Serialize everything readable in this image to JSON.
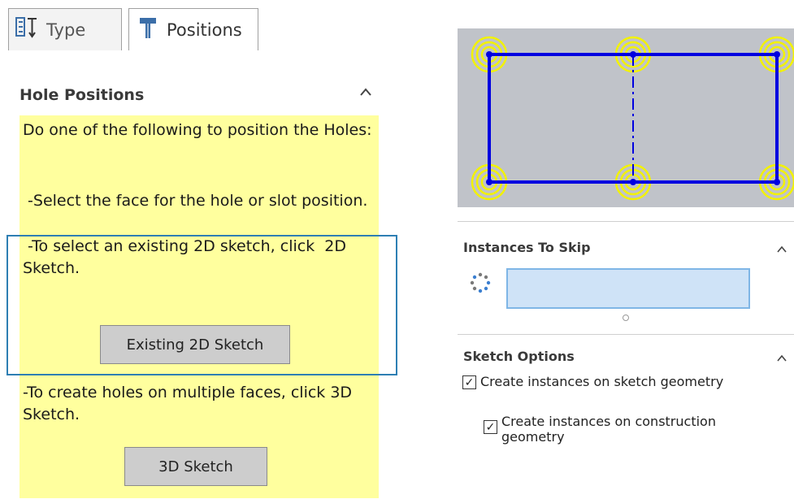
{
  "tabs": [
    {
      "label": "Type",
      "icon": "type-icon"
    },
    {
      "label": "Positions",
      "icon": "positions-icon"
    }
  ],
  "hole_positions": {
    "title": "Hole Positions",
    "instructions": [
      "Do one of the following to position the Holes:",
      " -Select the face for the hole or slot position.",
      " -To select an existing 2D sketch, click  2D Sketch.",
      "-To create holes on multiple faces, click 3D Sketch."
    ],
    "existing_2d_button": "Existing 2D Sketch",
    "sketch_3d_button": "3D Sketch",
    "collapse_icon": "chevron-up-icon"
  },
  "preview": {
    "background": "#c0c3c9",
    "line_color": "#0000e0",
    "marker_color": "#f2f200"
  },
  "instances_to_skip": {
    "title": "Instances To Skip",
    "icon": "instances-skip-icon",
    "value": ""
  },
  "sketch_options": {
    "title": "Sketch Options",
    "options": [
      {
        "label": "Create instances on sketch geometry",
        "checked": true
      },
      {
        "label": "Create instances on construction geometry",
        "checked": true
      }
    ]
  },
  "colors": {
    "highlight": "#ffff9e",
    "focus_box": "#2e7fb3",
    "field_fill": "#cfe3f7"
  }
}
